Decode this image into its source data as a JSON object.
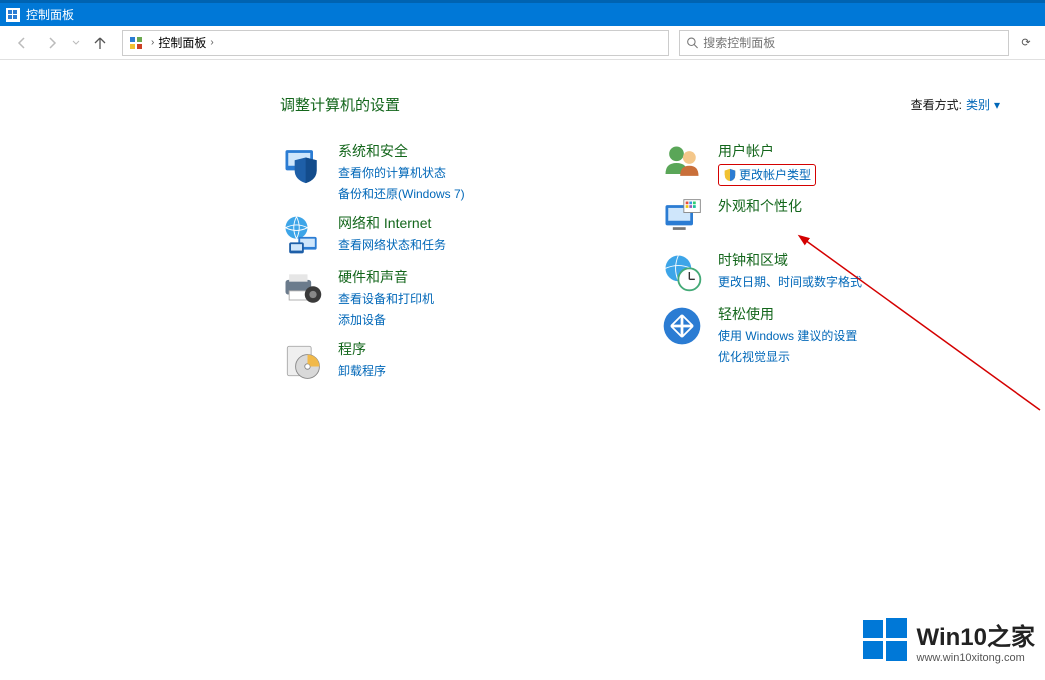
{
  "titlebar": {
    "title": "控制面板"
  },
  "nav": {
    "breadcrumb_root": "控制面板",
    "search_placeholder": "搜索控制面板",
    "refresh_label": "⟳"
  },
  "heading": "调整计算机的设置",
  "viewby": {
    "label": "查看方式:",
    "value": "类别",
    "caret": "▾"
  },
  "left": [
    {
      "title": "系统和安全",
      "sub": [
        {
          "text": "查看你的计算机状态"
        },
        {
          "text": "备份和还原(Windows 7)"
        }
      ]
    },
    {
      "title": "网络和 Internet",
      "sub": [
        {
          "text": "查看网络状态和任务"
        }
      ]
    },
    {
      "title": "硬件和声音",
      "sub": [
        {
          "text": "查看设备和打印机"
        },
        {
          "text": "添加设备"
        }
      ]
    },
    {
      "title": "程序",
      "sub": [
        {
          "text": "卸载程序"
        }
      ]
    }
  ],
  "right": [
    {
      "title": "用户帐户",
      "sub": [
        {
          "text": "更改帐户类型",
          "shield": true,
          "highlight": true
        }
      ]
    },
    {
      "title": "外观和个性化",
      "sub": []
    },
    {
      "title": "时钟和区域",
      "sub": [
        {
          "text": "更改日期、时间或数字格式"
        }
      ]
    },
    {
      "title": "轻松使用",
      "sub": [
        {
          "text": "使用 Windows 建议的设置"
        },
        {
          "text": "优化视觉显示"
        }
      ]
    }
  ],
  "watermark": {
    "brand": "Win10之家",
    "url": "www.win10xitong.com"
  }
}
